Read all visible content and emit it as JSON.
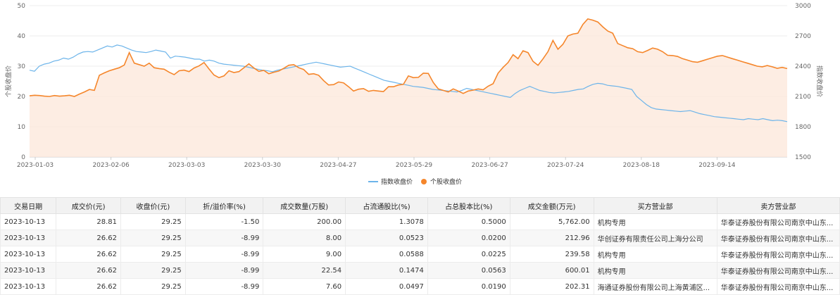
{
  "chart_data": {
    "type": "line",
    "title": "",
    "x_labels": [
      "2023-01-03",
      "2023-02-06",
      "2023-03-03",
      "2023-03-30",
      "2023-04-27",
      "2023-05-29",
      "2023-06-27",
      "2023-07-24",
      "2023-08-18",
      "2023-09-14"
    ],
    "y_left": {
      "label": "个股收盘价",
      "ticks": [
        0,
        10,
        20,
        30,
        40,
        50
      ],
      "range": [
        0,
        50
      ]
    },
    "y_right": {
      "label": "指数收盘价",
      "ticks": [
        1500,
        1800,
        2100,
        2400,
        2700,
        3000
      ],
      "range": [
        1500,
        3000
      ]
    },
    "legend_position": "bottom-center",
    "grid": "horizontal",
    "series": [
      {
        "name": "指数收盘价",
        "axis": "right",
        "color": "#6cb4ea",
        "values": [
          2360,
          2350,
          2400,
          2420,
          2430,
          2450,
          2460,
          2480,
          2470,
          2490,
          2520,
          2540,
          2545,
          2540,
          2560,
          2580,
          2600,
          2590,
          2610,
          2600,
          2580,
          2560,
          2545,
          2540,
          2535,
          2545,
          2560,
          2550,
          2540,
          2480,
          2500,
          2495,
          2490,
          2480,
          2470,
          2470,
          2450,
          2460,
          2450,
          2430,
          2420,
          2415,
          2410,
          2405,
          2400,
          2390,
          2380,
          2370,
          2360,
          2355,
          2345,
          2360,
          2370,
          2380,
          2390,
          2400,
          2410,
          2420,
          2430,
          2440,
          2430,
          2420,
          2410,
          2400,
          2390,
          2395,
          2400,
          2380,
          2360,
          2340,
          2320,
          2300,
          2280,
          2260,
          2250,
          2240,
          2230,
          2220,
          2210,
          2200,
          2195,
          2190,
          2180,
          2170,
          2165,
          2160,
          2155,
          2150,
          2145,
          2160,
          2180,
          2170,
          2160,
          2150,
          2140,
          2130,
          2120,
          2110,
          2100,
          2090,
          2130,
          2160,
          2180,
          2200,
          2180,
          2160,
          2150,
          2140,
          2135,
          2140,
          2145,
          2150,
          2160,
          2170,
          2175,
          2200,
          2220,
          2230,
          2225,
          2210,
          2205,
          2200,
          2190,
          2180,
          2170,
          2100,
          2060,
          2020,
          1990,
          1975,
          1970,
          1965,
          1960,
          1955,
          1950,
          1955,
          1960,
          1945,
          1930,
          1920,
          1910,
          1900,
          1895,
          1890,
          1885,
          1880,
          1875,
          1870,
          1880,
          1875,
          1870,
          1880,
          1870,
          1860,
          1865,
          1860,
          1850
        ]
      },
      {
        "name": "个股收盘价",
        "axis": "left",
        "color": "#f5862b",
        "values": [
          20.2,
          20.4,
          20.3,
          20.1,
          20.0,
          20.3,
          20.1,
          20.2,
          20.4,
          20.0,
          20.8,
          21.5,
          22.3,
          22.0,
          27.0,
          27.8,
          28.5,
          29.0,
          29.5,
          30.4,
          34.5,
          31.0,
          30.5,
          30.0,
          31.0,
          29.5,
          29.2,
          29.0,
          28.0,
          27.2,
          28.5,
          28.7,
          28.2,
          29.4,
          30.1,
          31.2,
          29.1,
          27.1,
          26.2,
          26.8,
          28.5,
          27.9,
          28.2,
          29.5,
          30.8,
          29.4,
          28.3,
          28.6,
          27.5,
          28.0,
          28.4,
          29.3,
          30.3,
          30.5,
          29.5,
          28.9,
          27.3,
          27.5,
          27.0,
          25.2,
          23.8,
          23.9,
          24.8,
          24.5,
          23.2,
          21.8,
          22.4,
          22.6,
          21.7,
          22.0,
          21.8,
          21.6,
          23.2,
          23.2,
          23.8,
          24.0,
          26.8,
          26.2,
          26.3,
          27.7,
          27.6,
          24.6,
          22.5,
          22.0,
          21.5,
          22.5,
          21.8,
          21.0,
          21.8,
          22.1,
          22.5,
          22.2,
          23.4,
          24.2,
          27.7,
          29.6,
          31.2,
          33.8,
          32.5,
          35.1,
          34.5,
          31.6,
          30.3,
          32.4,
          34.8,
          38.5,
          35.6,
          37.2,
          40.0,
          40.6,
          40.9,
          43.8,
          45.6,
          45.2,
          44.6,
          43.0,
          41.6,
          40.9,
          37.5,
          36.8,
          36.1,
          35.8,
          34.8,
          34.5,
          35.2,
          36.0,
          35.6,
          34.8,
          33.6,
          33.5,
          33.2,
          32.5,
          32.0,
          31.5,
          31.3,
          31.8,
          32.3,
          32.8,
          33.3,
          33.5,
          33.0,
          32.5,
          32.0,
          31.5,
          31.0,
          30.5,
          30.0,
          29.8,
          30.2,
          29.8,
          29.3,
          29.6,
          29.2
        ]
      }
    ]
  },
  "table": {
    "headers": [
      "交易日期",
      "成交价(元)",
      "收盘价(元)",
      "折/溢价率(%)",
      "成交数量(万股)",
      "占流通股比(%)",
      "占总股本比(%)",
      "成交金额(万元)",
      "买方营业部",
      "卖方营业部"
    ],
    "rows": [
      [
        "2023-10-13",
        "28.81",
        "29.25",
        "-1.50",
        "200.00",
        "1.3078",
        "0.5000",
        "5,762.00",
        "机构专用",
        "华泰证券股份有限公司南京中山东..."
      ],
      [
        "2023-10-13",
        "26.62",
        "29.25",
        "-8.99",
        "8.00",
        "0.0523",
        "0.0200",
        "212.96",
        "华创证券有限责任公司上海分公司",
        "华泰证券股份有限公司南京中山东..."
      ],
      [
        "2023-10-13",
        "26.62",
        "29.25",
        "-8.99",
        "9.00",
        "0.0588",
        "0.0225",
        "239.58",
        "机构专用",
        "华泰证券股份有限公司南京中山东..."
      ],
      [
        "2023-10-13",
        "26.62",
        "29.25",
        "-8.99",
        "22.54",
        "0.1474",
        "0.0563",
        "600.01",
        "机构专用",
        "华泰证券股份有限公司南京中山东..."
      ],
      [
        "2023-10-13",
        "26.62",
        "29.25",
        "-8.99",
        "7.60",
        "0.0497",
        "0.0190",
        "202.31",
        "海通证券股份有限公司上海黄浦区...",
        "华泰证券股份有限公司南京中山东..."
      ]
    ]
  }
}
